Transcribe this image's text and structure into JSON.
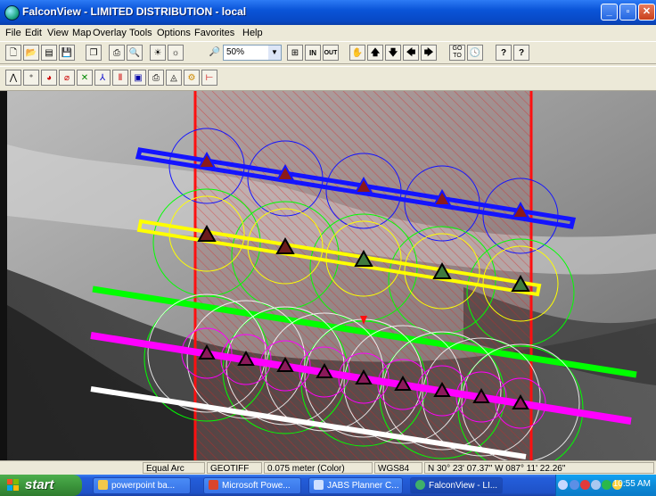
{
  "window": {
    "title": "FalconView - LIMITED DISTRIBUTION - local"
  },
  "menu": [
    "File",
    "Edit",
    "View",
    "Map",
    "Overlay",
    "Tools",
    "Options",
    "Favorites",
    "Help"
  ],
  "toolbar": {
    "zoom_value": "50%",
    "zoom_in_label": "IN",
    "zoom_out_label": "OUT",
    "goto_label": "GO TO",
    "help_label": "?",
    "context_help_label": "?"
  },
  "status": {
    "projection": "Equal Arc",
    "map_type": "GEOTIFF",
    "resolution": "0.075 meter (Color)",
    "datum": "WGS84",
    "coordinates": "N  30° 23' 07.37\"  W  087° 11' 22.26\""
  },
  "taskbar": {
    "start_label": "start",
    "items": [
      {
        "label": "powerpoint ba...",
        "icon": "folder-icon",
        "color": "#f2c84b"
      },
      {
        "label": "Microsoft Powe...",
        "icon": "powerpoint-icon",
        "color": "#d9452b"
      },
      {
        "label": "JABS Planner C...",
        "icon": "window-icon",
        "color": "#cfe0ff"
      },
      {
        "label": "FalconView - LI...",
        "icon": "falconview-icon",
        "color": "#3fb06a"
      }
    ],
    "clock": "10:55 AM"
  },
  "map": {
    "colors": {
      "blue": "#1414ff",
      "yellow": "#ffff00",
      "green": "#00ff00",
      "magenta": "#ff00ff",
      "white": "#ffffff",
      "red": "#ff1010"
    }
  }
}
